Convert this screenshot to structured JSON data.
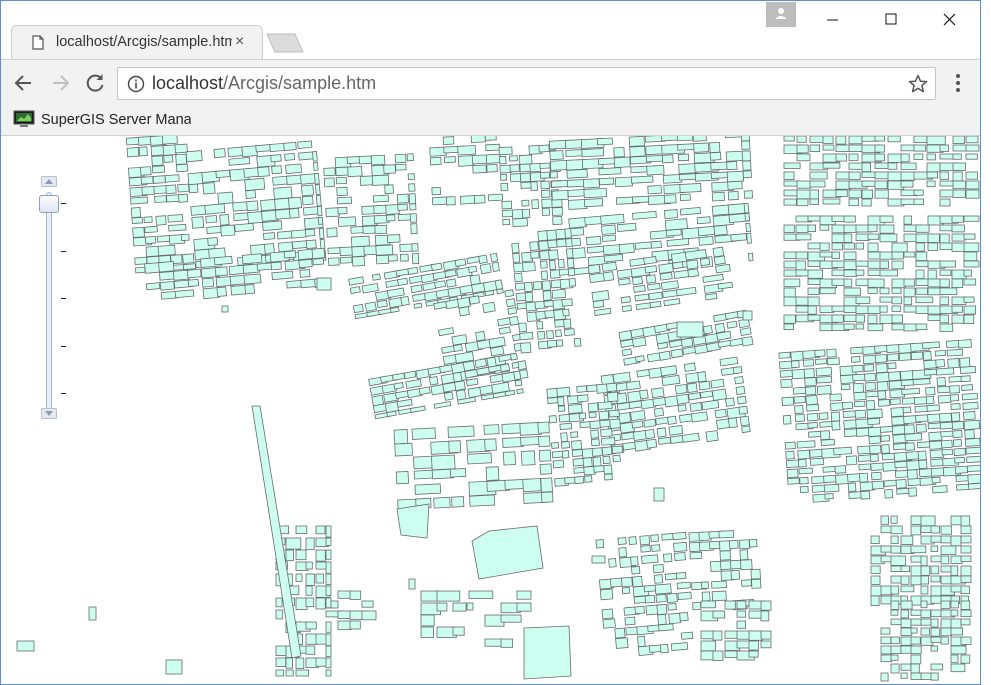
{
  "browser": {
    "tab_title": "localhost/Arcgis/sample.htm",
    "tab_close": "×",
    "url_host": "localhost",
    "url_path": "/Arcgis/sample.htm"
  },
  "bookmarks": [
    {
      "label": "SuperGIS Server Manager"
    }
  ],
  "icons": {
    "tab": "page-icon",
    "back": "back-arrow-icon",
    "forward": "forward-arrow-icon",
    "reload": "reload-icon",
    "info": "info-icon",
    "star": "star-icon",
    "menu": "kebab-menu-icon",
    "profile": "person-icon"
  },
  "map": {
    "zoom_levels": 5,
    "zoom_selected_level": 1,
    "building_fill": "#ccfff0",
    "building_stroke": "#6a6a6a"
  }
}
